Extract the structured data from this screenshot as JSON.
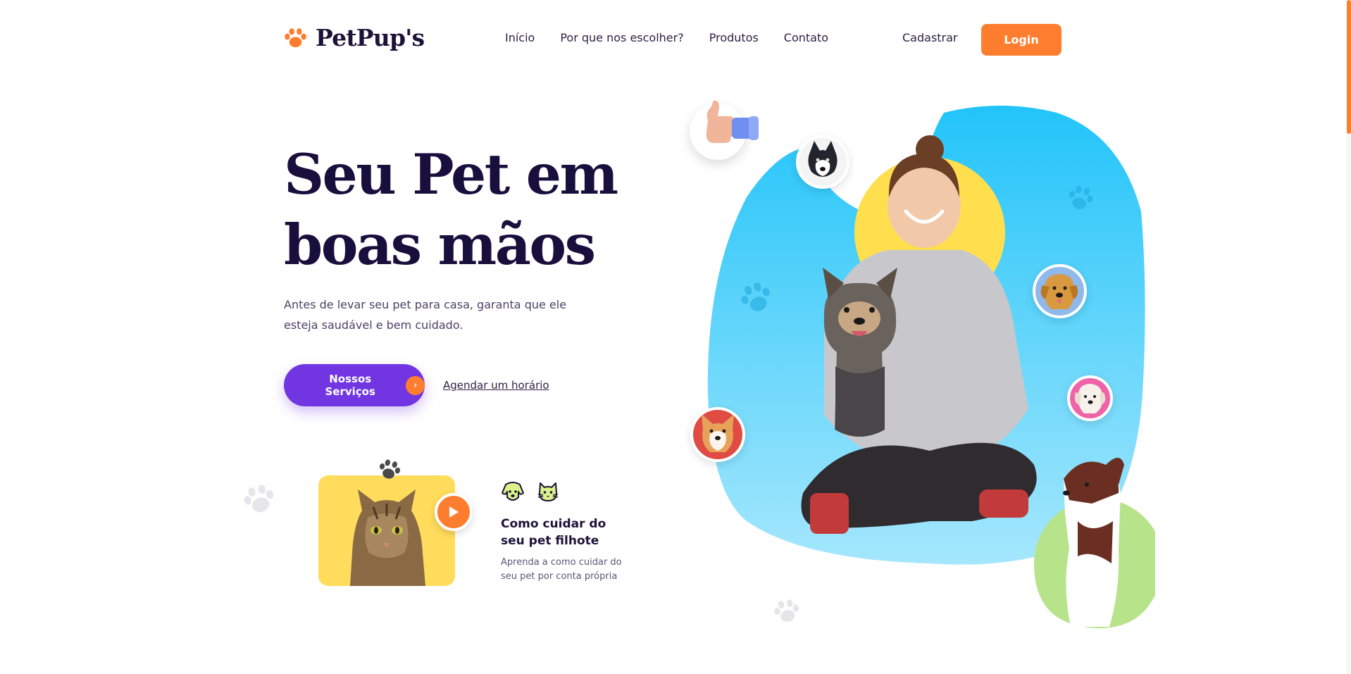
{
  "brand": {
    "name": "PetPup's",
    "icon": "paw-icon"
  },
  "nav": {
    "items": [
      {
        "label": "Início"
      },
      {
        "label": "Por que nos escolher?"
      },
      {
        "label": "Produtos"
      },
      {
        "label": "Contato"
      }
    ],
    "signup_label": "Cadastrar",
    "login_label": "Login"
  },
  "hero": {
    "title_line1": "Seu Pet em",
    "title_line2": "boas mãos",
    "subtitle": "Antes de levar seu pet para casa, garanta que ele esteja saudável e bem cuidado.",
    "primary_button": "Nossos Serviços",
    "secondary_link": "Agendar um horário"
  },
  "tip_card": {
    "title": "Como cuidar do seu pet filhote",
    "description": "Aprenda a como cuidar do seu pet por conta própria",
    "icons": [
      "dog-icon",
      "cat-icon"
    ]
  },
  "colors": {
    "accent": "#ff7d2e",
    "primary": "#7136e2",
    "heading": "#180f3d",
    "blob_blue": "#29c4f9",
    "yellow": "#ffdc5c",
    "green": "#b7e48a"
  }
}
